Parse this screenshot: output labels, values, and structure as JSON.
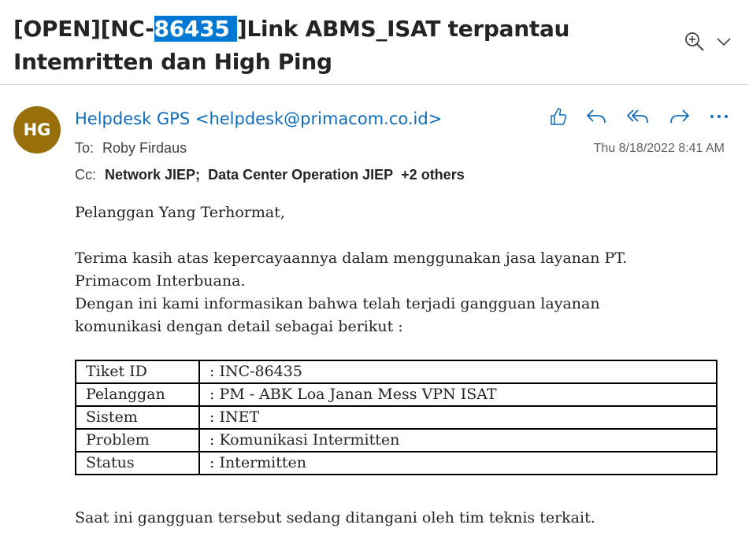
{
  "header": {
    "subject_prefix": "[OPEN][NC-",
    "subject_highlight": "86435 ",
    "subject_suffix": "]Link ABMS_ISAT terpantau Intemritten dan High Ping",
    "icons": [
      "zoom-in-icon",
      "chevron-down-icon"
    ]
  },
  "message": {
    "avatar_initials": "HG",
    "avatar_color": "#986f0b",
    "sender": "Helpdesk GPS <helpdesk@primacom.co.id>",
    "to_label": "To:",
    "to": "Roby Firdaus",
    "cc_label": "Cc:",
    "cc": [
      "Network JIEP;",
      "Data Center Operation JIEP"
    ],
    "cc_more": "+2 others",
    "date": "Thu 8/18/2022 8:41 AM",
    "actions": [
      "like-icon",
      "reply-icon",
      "reply-all-icon",
      "forward-icon",
      "more-icon"
    ]
  },
  "body": {
    "greeting": "Pelanggan Yang Terhormat,",
    "para_line1": "Terima kasih atas kepercayaannya dalam menggunakan jasa layanan PT.",
    "para_line2": "Primacom Interbuana.",
    "para_line3": "Dengan ini kami informasikan bahwa telah terjadi gangguan layanan",
    "para_line4": "komunikasi dengan detail sebagai berikut :",
    "table": [
      {
        "key": "Tiket ID",
        "value": ": INC-86435"
      },
      {
        "key": "Pelanggan",
        "value": ": PM - ABK Loa Janan Mess VPN ISAT"
      },
      {
        "key": "Sistem",
        "value": ": INET"
      },
      {
        "key": "Problem",
        "value": ": Komunikasi Intermitten"
      },
      {
        "key": "Status",
        "value": ": Intermitten"
      }
    ],
    "closing": "Saat ini gangguan tersebut sedang ditangani oleh tim teknis terkait."
  },
  "colors": {
    "accent": "#0f6cbd",
    "highlight": "#0078d4"
  }
}
